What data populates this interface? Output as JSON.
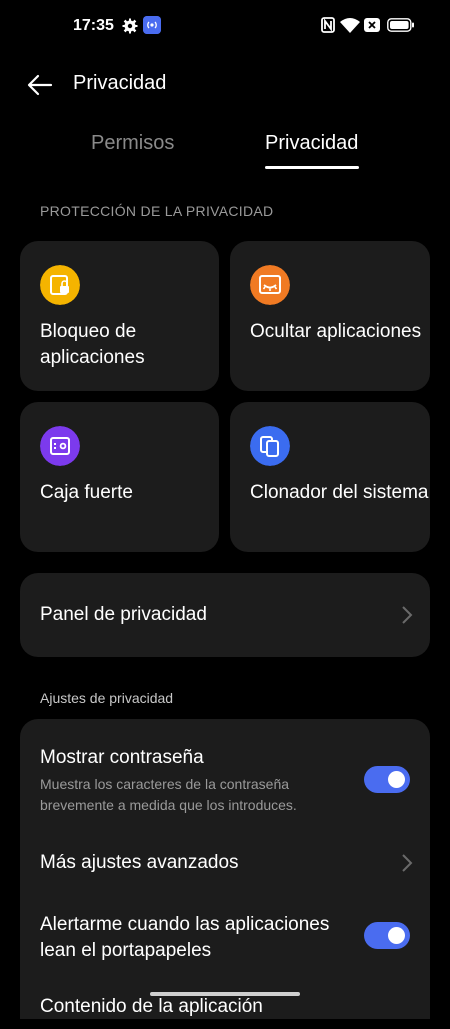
{
  "status_bar": {
    "time": "17:35",
    "icons": [
      "gear-icon",
      "cast-icon",
      "nfc-icon",
      "wifi-icon",
      "no-sim-icon",
      "battery-icon"
    ]
  },
  "header": {
    "title": "Privacidad"
  },
  "tabs": [
    {
      "label": "Permisos",
      "active": false
    },
    {
      "label": "Privacidad",
      "active": true
    }
  ],
  "protection": {
    "header": "PROTECCIÓN DE LA PRIVACIDAD",
    "cards": [
      {
        "label": "Bloqueo de aplicaciones",
        "icon": "app-lock-icon",
        "color": "#f5b400"
      },
      {
        "label": "Ocultar aplicaciones",
        "icon": "hide-apps-icon",
        "color": "#f07a23"
      },
      {
        "label": "Caja fuerte",
        "icon": "safe-icon",
        "color": "#7c3aed"
      },
      {
        "label": "Clonador del sistema",
        "icon": "system-clone-icon",
        "color": "#3b6cf0"
      }
    ]
  },
  "panel": {
    "label": "Panel de privacidad"
  },
  "settings": {
    "header": "Ajustes de privacidad",
    "rows": [
      {
        "title": "Mostrar contraseña",
        "subtitle": "Muestra los caracteres de la contraseña brevemente a medida que los introduces.",
        "toggle": true
      },
      {
        "title": "Más ajustes avanzados"
      },
      {
        "title": "Alertarme cuando las aplicaciones lean el portapapeles",
        "toggle": true
      },
      {
        "title": "Contenido de la aplicación"
      }
    ]
  },
  "colors": {
    "accent": "#4a6cf0",
    "card": "#1c1c1c",
    "background": "#000000"
  }
}
